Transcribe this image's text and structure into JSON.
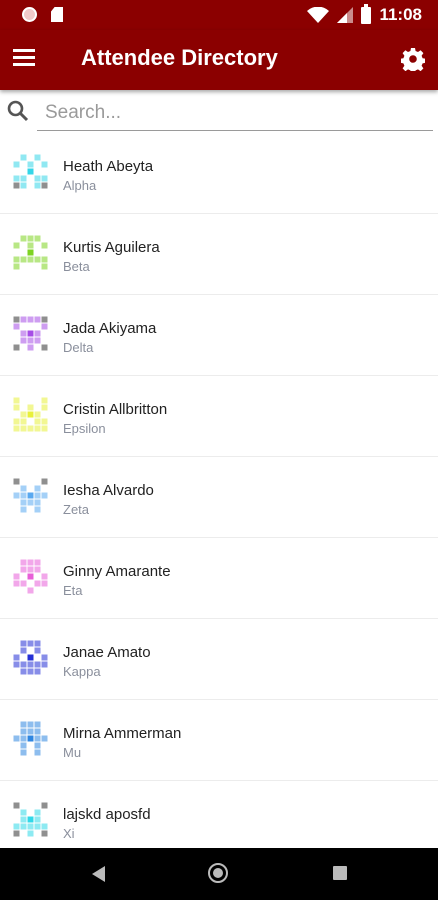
{
  "status_bar": {
    "time": "11:08",
    "icons": [
      "record-icon",
      "sd-card-icon",
      "wifi-icon",
      "signal-icon",
      "battery-icon"
    ]
  },
  "app_bar": {
    "title": "Attendee Directory",
    "background": "#8b0000",
    "icons": [
      "menu-icon",
      "gear-icon"
    ]
  },
  "search": {
    "placeholder": "Search...",
    "value": ""
  },
  "attendees": [
    {
      "name": "Heath Abeyta",
      "group": "Alpha",
      "avatar_color": "#34d6e8"
    },
    {
      "name": "Kurtis Aguilera",
      "group": "Beta",
      "avatar_color": "#7ed321"
    },
    {
      "name": "Jada Akiyama",
      "group": "Delta",
      "avatar_color": "#a64de6"
    },
    {
      "name": "Cristin Allbritton",
      "group": "Epsilon",
      "avatar_color": "#e8f03a"
    },
    {
      "name": "Iesha Alvardo",
      "group": "Zeta",
      "avatar_color": "#5aa9f0"
    },
    {
      "name": "Ginny Amarante",
      "group": "Eta",
      "avatar_color": "#e85fd8"
    },
    {
      "name": "Janae Amato",
      "group": "Kappa",
      "avatar_color": "#2530d6"
    },
    {
      "name": "Mirna Ammerman",
      "group": "Mu",
      "avatar_color": "#2f86e0"
    },
    {
      "name": "lajskd aposfd",
      "group": "Xi",
      "avatar_color": "#30d8e8"
    }
  ],
  "nav_bar": {
    "icons": [
      "back-icon",
      "home-icon",
      "recent-apps-icon"
    ]
  }
}
